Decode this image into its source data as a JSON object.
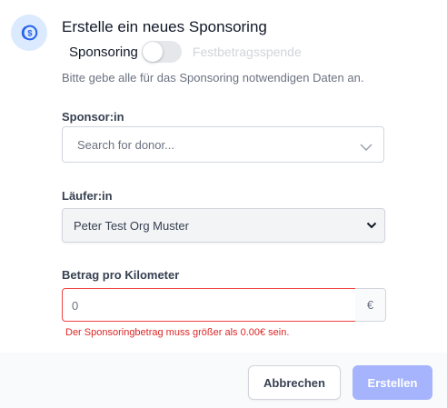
{
  "dialog": {
    "title": "Erstelle ein neues Sponsoring",
    "subtitle": "Bitte gebe alle für das Sponsoring notwendigen Daten an.",
    "icon": "coin-icon",
    "accent": "#2563eb"
  },
  "type_toggle": {
    "left_label": "Sponsoring",
    "right_label": "Festbetragsspende",
    "state": "Sponsoring"
  },
  "sponsor": {
    "label": "Sponsor:in",
    "placeholder": "Search for donor..."
  },
  "runner": {
    "label": "Läufer:in",
    "selected": "Peter Test Org Muster"
  },
  "amount": {
    "label": "Betrag pro Kilometer",
    "value": "0",
    "unit": "€",
    "error": "Der Sponsoringbetrag muss größer als 0.00€ sein.",
    "error_color": "#dc2626"
  },
  "actions": {
    "cancel_label": "Abbrechen",
    "create_label": "Erstellen",
    "create_color": "#a5b4fc"
  }
}
